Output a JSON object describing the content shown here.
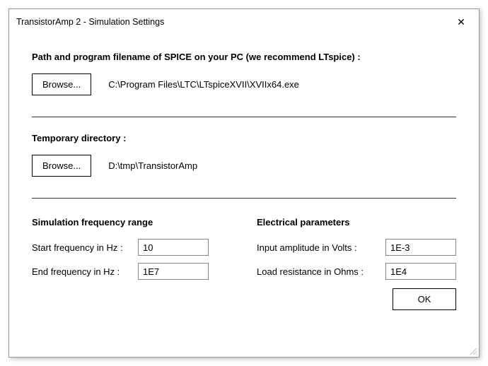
{
  "window": {
    "title": "TransistorAmp 2 - Simulation Settings"
  },
  "spice": {
    "heading": "Path and program filename of SPICE on your PC (we recommend LTspice) :",
    "browse_label": "Browse...",
    "path": "C:\\Program Files\\LTC\\LTspiceXVII\\XVIIx64.exe"
  },
  "tempdir": {
    "heading": "Temporary directory :",
    "browse_label": "Browse...",
    "path": "D:\\tmp\\TransistorAmp"
  },
  "freq": {
    "heading": "Simulation frequency range",
    "start_label": "Start frequency in Hz :",
    "start_value": "10",
    "end_label": "End frequency in Hz :",
    "end_value": "1E7"
  },
  "elec": {
    "heading": "Electrical parameters",
    "amp_label": "Input amplitude in Volts :",
    "amp_value": "1E-3",
    "load_label": "Load resistance in Ohms :",
    "load_value": "1E4"
  },
  "buttons": {
    "ok": "OK"
  }
}
